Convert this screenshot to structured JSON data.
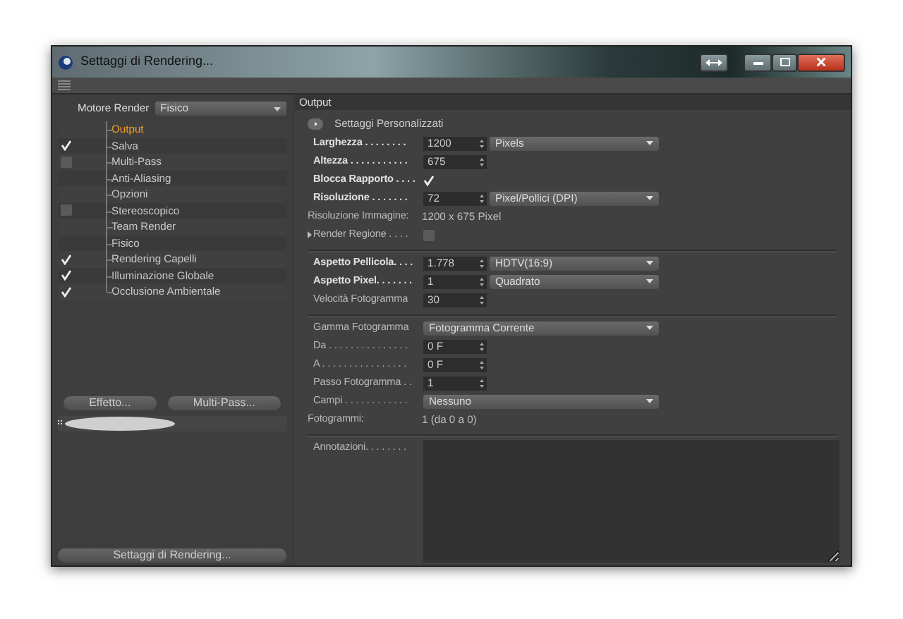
{
  "window": {
    "title": "Settaggi di Rendering..."
  },
  "engine": {
    "label": "Motore Render",
    "value": "Fisico"
  },
  "tree": [
    {
      "label": "Output",
      "kind": "plain",
      "selected": true
    },
    {
      "label": "Salva",
      "kind": "check",
      "checked": true,
      "selected": false
    },
    {
      "label": "Multi-Pass",
      "kind": "check",
      "checked": false,
      "selected": false
    },
    {
      "label": "Anti-Aliasing",
      "kind": "plain",
      "selected": false
    },
    {
      "label": "Opzioni",
      "kind": "plain",
      "selected": false
    },
    {
      "label": "Stereoscopico",
      "kind": "check",
      "checked": false,
      "selected": false
    },
    {
      "label": "Team Render",
      "kind": "plain",
      "selected": false
    },
    {
      "label": "Fisico",
      "kind": "plain",
      "selected": false
    },
    {
      "label": "Rendering Capelli",
      "kind": "check",
      "checked": true,
      "selected": false
    },
    {
      "label": "Illuminazione Globale",
      "kind": "check",
      "checked": true,
      "selected": false
    },
    {
      "label": "Occlusione Ambientale",
      "kind": "check",
      "checked": true,
      "selected": false
    }
  ],
  "left_buttons": [
    "Effetto...",
    "Multi-Pass..."
  ],
  "bottom_button": "Settaggi di Rendering...",
  "panel": {
    "title": "Output",
    "preset": "Settaggi Personalizzati",
    "groups": [
      [
        {
          "kind": "numsel",
          "label": "Larghezza . . . . . . . .",
          "bold": true,
          "value": "1200",
          "option": "Pixels"
        },
        {
          "kind": "num",
          "label": "Altezza . . . . . . . . . . .",
          "bold": true,
          "value": "675"
        },
        {
          "kind": "check",
          "label": "Blocca Rapporto . . . .",
          "bold": true,
          "checked": true
        },
        {
          "kind": "numsel",
          "label": "Risoluzione . . . . . . .",
          "bold": true,
          "value": "72",
          "option": "Pixel/Pollici (DPI)"
        },
        {
          "kind": "info",
          "label": "Risoluzione Immagine:",
          "value": "1200 x 675 Pixel"
        },
        {
          "kind": "expcheck",
          "label": "Render Regione . . . .",
          "bold": false,
          "checked": false
        }
      ],
      [
        {
          "kind": "numsel",
          "label": "Aspetto Pellicola. . . .",
          "bold": true,
          "value": "1.778",
          "option": "HDTV(16:9)"
        },
        {
          "kind": "numsel",
          "label": "Aspetto Pixel. . . . . . .",
          "bold": true,
          "value": "1",
          "option": "Quadrato"
        },
        {
          "kind": "num",
          "label": "Velocità Fotogramma",
          "bold": false,
          "value": "30"
        }
      ],
      [
        {
          "kind": "sel",
          "label": "Gamma Fotogramma",
          "bold": false,
          "option": "Fotogramma Corrente"
        },
        {
          "kind": "num",
          "label": "Da . . . . . . . . . . . . . . .",
          "bold": false,
          "value": "0 F"
        },
        {
          "kind": "num",
          "label": "A . . . . . . . . . . . . . . . .",
          "bold": false,
          "value": "0 F"
        },
        {
          "kind": "num",
          "label": "Passo Fotogramma . .",
          "bold": false,
          "value": "1"
        },
        {
          "kind": "sel",
          "label": "Campi . . . . . . . . . . . .",
          "bold": false,
          "option": "Nessuno"
        },
        {
          "kind": "info",
          "label": "Fotogrammi:",
          "value": "1 (da 0 a 0)"
        }
      ]
    ],
    "notes_label": "Annotazioni. . . . . . . ."
  }
}
